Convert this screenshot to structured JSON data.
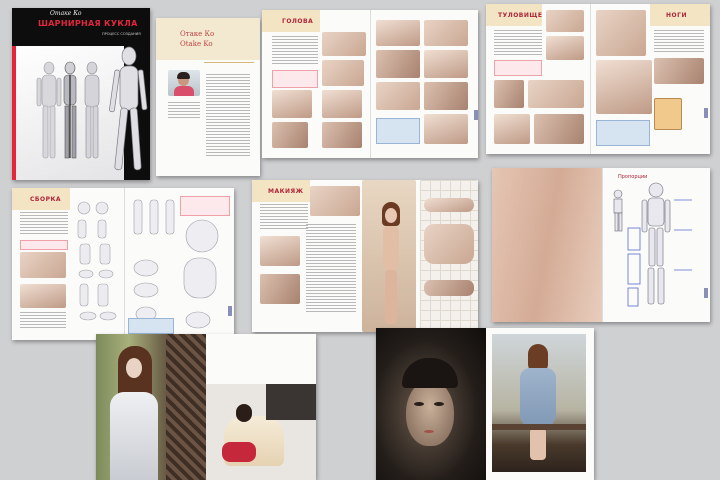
{
  "cover": {
    "author": "Отаке Ко",
    "title": "ШАРНИРНАЯ КУКЛА",
    "subtitle": "ПРОЦЕСС СОЗДАНИЯ"
  },
  "author_page": {
    "name_ru": "Отаке Ко",
    "name_en": "Otake Ko"
  },
  "spreads": {
    "head": "ГОЛОВА",
    "body": "ТУЛОВИЩЕ",
    "legs": "НОГИ",
    "assembly": "СБОРКА",
    "makeup": "МАКИЯЖ",
    "proportions": "Пропорции"
  }
}
